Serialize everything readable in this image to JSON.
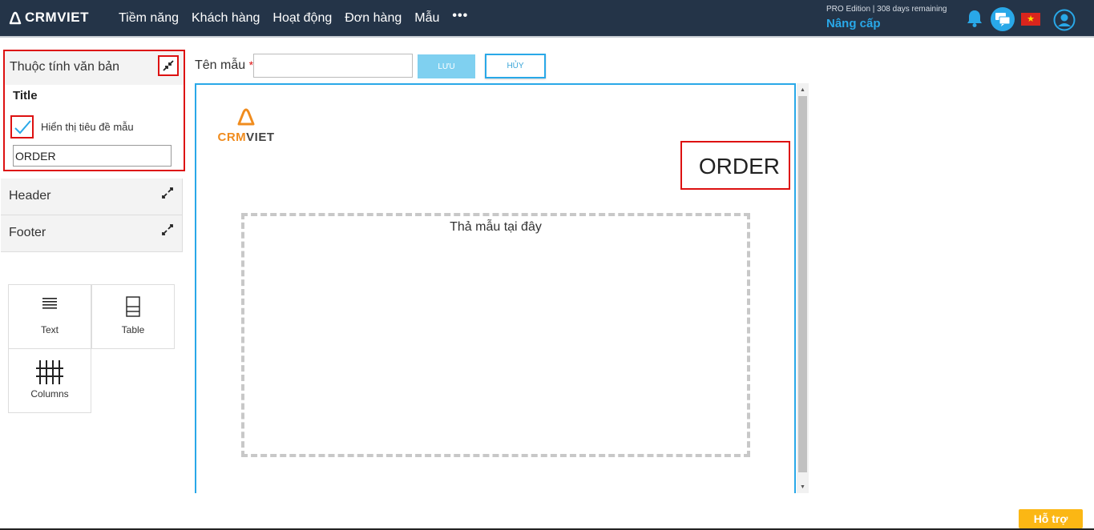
{
  "header": {
    "logo_text": "CRMVIET",
    "nav": [
      "Tiềm năng",
      "Khách hàng",
      "Hoạt động",
      "Đơn hàng",
      "Mẫu"
    ],
    "more": "•••",
    "edition": "PRO Edition | 308 days remaining",
    "upgrade": "Nâng cấp",
    "flag_star": "★"
  },
  "sidebar": {
    "title_panel": {
      "heading": "Thuộc tính văn bản",
      "title_label": "Title",
      "checkbox_label": "Hiển thị tiêu đề mẫu",
      "checkbox_checked": true,
      "title_value": "ORDER"
    },
    "sections": [
      "Header",
      "Footer"
    ],
    "tools": [
      "Text",
      "Table",
      "Columns"
    ]
  },
  "form": {
    "name_label": "Tên mẫu",
    "required_mark": "*",
    "name_value": "",
    "save_label": "LƯU",
    "cancel_label": "HỦY"
  },
  "document": {
    "logo_crm": "CRM",
    "logo_viet": "VIET",
    "title": "ORDER",
    "dropzone_text": "Thả mẫu tại đây"
  },
  "support_label": "Hỗ trợ",
  "colors": {
    "topbar": "#243448",
    "accent": "#29a8e8",
    "highlight": "#dd1111",
    "support": "#fbb714",
    "logo_orange": "#f08c1e"
  }
}
